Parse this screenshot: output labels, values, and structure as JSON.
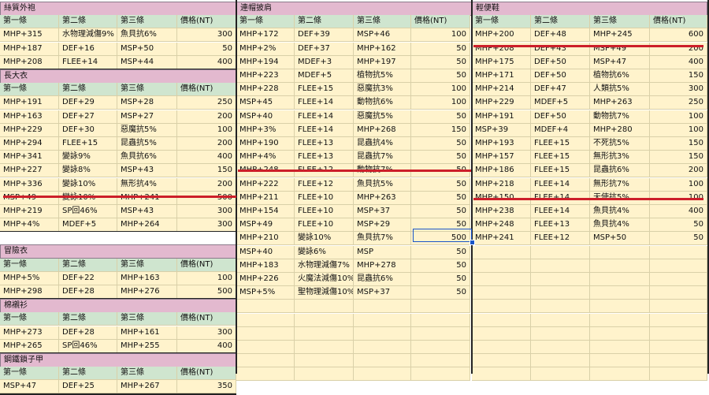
{
  "headers": [
    "第一條",
    "第二條",
    "第三條",
    "價格(NT)"
  ],
  "sections_left": [
    {
      "title": "絲質外袍",
      "rows": [
        [
          "MHP+315",
          "水物理減傷9%",
          "魚貝抗6%",
          "300"
        ],
        [
          "MHP+187",
          "DEF+16",
          "MSP+50",
          "50"
        ],
        [
          "MHP+208",
          "FLEE+14",
          "MSP+44",
          "400"
        ]
      ]
    },
    {
      "title": "長大衣",
      "rows": [
        [
          "MHP+191",
          "DEF+29",
          "MSP+28",
          "250"
        ],
        [
          "MHP+163",
          "DEF+27",
          "MSP+27",
          "200"
        ],
        [
          "MHP+229",
          "DEF+30",
          "惡魔抗5%",
          "100"
        ],
        [
          "MHP+294",
          "FLEE+15",
          "昆蟲抗5%",
          "200"
        ],
        [
          "MHP+341",
          "變詠9%",
          "魚貝抗6%",
          "400"
        ],
        [
          "MHP+227",
          "變詠8%",
          "MSP+43",
          "150"
        ],
        [
          "MHP+336",
          "變詠10%",
          "無形抗4%",
          "200"
        ],
        [
          "MSP+49",
          "變詠10%",
          "MHP+241",
          "500"
        ],
        [
          "MHP+219",
          "SP回46%",
          "MSP+43",
          "300"
        ],
        [
          "MHP+4%",
          "MDEF+5",
          "MHP+264",
          "300"
        ]
      ]
    },
    {
      "title": "冒險衣",
      "rows": [
        [
          "MHP+5%",
          "DEF+22",
          "MHP+163",
          "100"
        ],
        [
          "MHP+298",
          "DEF+28",
          "MHP+276",
          "500"
        ]
      ]
    },
    {
      "title": "棉襯衫",
      "rows": [
        [
          "MHP+273",
          "DEF+28",
          "MHP+161",
          "300"
        ],
        [
          "MHP+265",
          "SP回46%",
          "MHP+255",
          "400"
        ]
      ]
    },
    {
      "title": "鋼鐵鎖子甲",
      "rows": [
        [
          "MSP+47",
          "DEF+25",
          "MHP+267",
          "350"
        ]
      ]
    }
  ],
  "section_middle": {
    "title": "連帽披肩",
    "rows": [
      [
        "MHP+172",
        "DEF+39",
        "MSP+46",
        "100"
      ],
      [
        "MHP+2%",
        "DEF+37",
        "MHP+162",
        "50"
      ],
      [
        "MHP+194",
        "MDEF+3",
        "MHP+197",
        "50"
      ],
      [
        "MHP+223",
        "MDEF+5",
        "植物抗5%",
        "50"
      ],
      [
        "MHP+228",
        "FLEE+15",
        "惡魔抗3%",
        "100"
      ],
      [
        "MSP+45",
        "FLEE+14",
        "動物抗6%",
        "100"
      ],
      [
        "MSP+40",
        "FLEE+14",
        "惡魔抗5%",
        "50"
      ],
      [
        "MHP+3%",
        "FLEE+14",
        "MHP+268",
        "150"
      ],
      [
        "MHP+190",
        "FLEE+13",
        "昆蟲抗4%",
        "50"
      ],
      [
        "MHP+4%",
        "FLEE+13",
        "昆蟲抗7%",
        "50"
      ],
      [
        "MHP+248",
        "FLEE+12",
        "動物抗7%",
        "50"
      ],
      [
        "MHP+222",
        "FLEE+12",
        "魚貝抗5%",
        "50"
      ],
      [
        "MHP+211",
        "FLEE+10",
        "MHP+263",
        "50"
      ],
      [
        "MHP+154",
        "FLEE+10",
        "MSP+37",
        "50"
      ],
      [
        "MSP+49",
        "FLEE+10",
        "MSP+29",
        "50"
      ],
      [
        "MHP+210",
        "變詠10%",
        "魚貝抗7%",
        "500"
      ],
      [
        "MSP+40",
        "變詠6%",
        "MSP",
        "50"
      ],
      [
        "MHP+183",
        "水物理減傷7%",
        "MHP+278",
        "50"
      ],
      [
        "MHP+226",
        "火魔法減傷10%",
        "昆蟲抗6%",
        "50"
      ],
      [
        "MSP+5%",
        "聖物理減傷10%",
        "MSP+37",
        "50"
      ]
    ]
  },
  "section_right": {
    "title": "輕便鞋",
    "rows": [
      [
        "MHP+200",
        "DEF+48",
        "MHP+245",
        "600"
      ],
      [
        "MHP+208",
        "DEF+43",
        "MSP+49",
        "200"
      ],
      [
        "MHP+175",
        "DEF+50",
        "MSP+47",
        "400"
      ],
      [
        "MHP+171",
        "DEF+50",
        "植物抗6%",
        "150"
      ],
      [
        "MHP+214",
        "DEF+47",
        "人類抗5%",
        "300"
      ],
      [
        "MHP+229",
        "MDEF+5",
        "MHP+263",
        "250"
      ],
      [
        "MHP+191",
        "DEF+50",
        "動物抗7%",
        "100"
      ],
      [
        "MSP+39",
        "MDEF+4",
        "MHP+280",
        "100"
      ],
      [
        "MHP+193",
        "FLEE+15",
        "不死抗5%",
        "150"
      ],
      [
        "MHP+157",
        "FLEE+15",
        "無形抗3%",
        "150"
      ],
      [
        "MHP+186",
        "FLEE+15",
        "昆蟲抗6%",
        "200"
      ],
      [
        "MHP+218",
        "FLEE+14",
        "無形抗7%",
        "100"
      ],
      [
        "MHP+150",
        "FLEE+14",
        "天使抗5%",
        "100"
      ],
      [
        "MHP+238",
        "FLEE+14",
        "魚貝抗4%",
        "400"
      ],
      [
        "MHP+248",
        "FLEE+13",
        "魚貝抗4%",
        "50"
      ],
      [
        "MHP+241",
        "FLEE+12",
        "MSP+50",
        "50"
      ]
    ]
  },
  "colors": {
    "title_bg": "#e3b9cf",
    "header_bg": "#cfe5cf",
    "row_bg": "#fff3cc",
    "strike": "#cc1f2a",
    "selection": "#1a56c8"
  }
}
